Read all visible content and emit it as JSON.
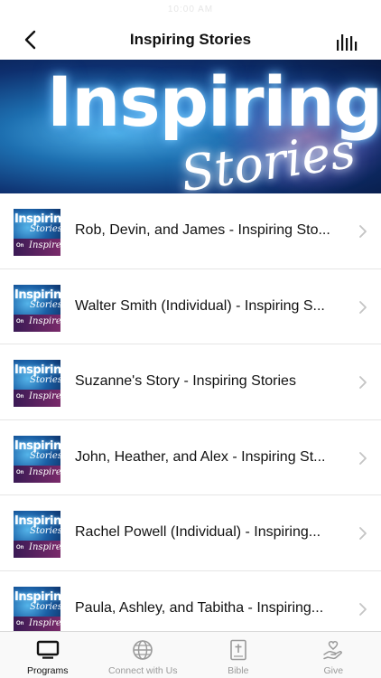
{
  "status_bar": {
    "time": "10:00 AM"
  },
  "header": {
    "title": "Inspiring Stories"
  },
  "hero": {
    "line1": "Inspiring",
    "line2": "Stories"
  },
  "thumbnail": {
    "line1": "Inspiring",
    "line2": "Stories",
    "line3": "On",
    "line4": "Inspire"
  },
  "episodes": [
    {
      "title": "Rob, Devin, and James - Inspiring Sto..."
    },
    {
      "title": "Walter Smith (Individual) - Inspiring S..."
    },
    {
      "title": "Suzanne's Story - Inspiring Stories"
    },
    {
      "title": "John, Heather, and Alex - Inspiring St..."
    },
    {
      "title": "Rachel Powell (Individual) - Inspiring..."
    },
    {
      "title": "Paula, Ashley, and Tabitha - Inspiring..."
    }
  ],
  "tabs": [
    {
      "label": "Programs",
      "icon": "tv-icon",
      "active": true
    },
    {
      "label": "Connect with Us",
      "icon": "globe-icon",
      "active": false
    },
    {
      "label": "Bible",
      "icon": "bible-icon",
      "active": false
    },
    {
      "label": "Give",
      "icon": "give-heart-hand-icon",
      "active": false
    }
  ],
  "colors": {
    "active_tab": "#111111",
    "inactive_tab": "#9a9a9a",
    "hero_blue": "#1d6fb0"
  }
}
